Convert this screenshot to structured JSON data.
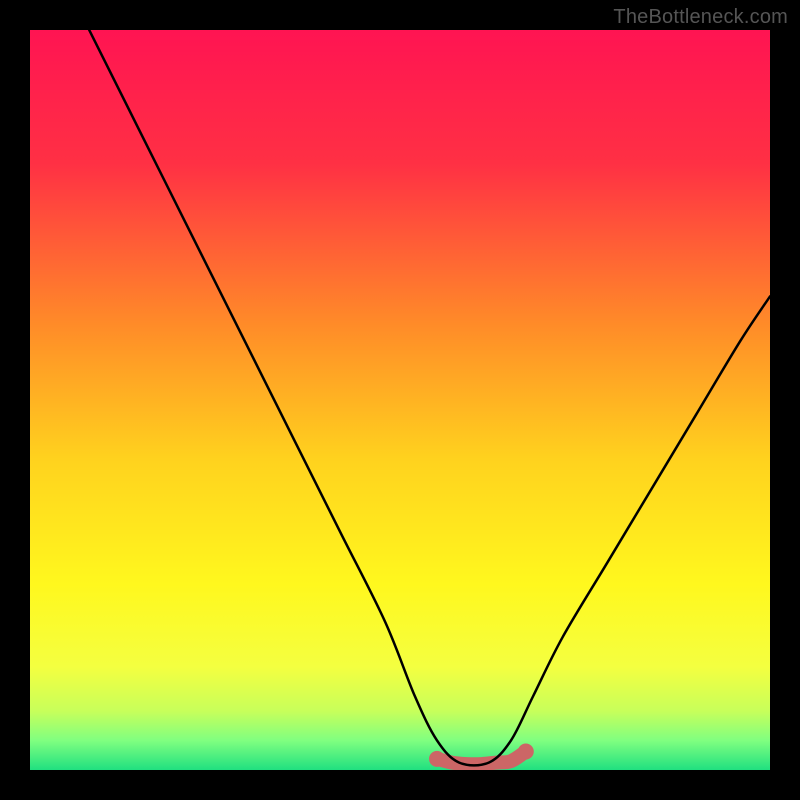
{
  "watermark": "TheBottleneck.com",
  "chart_data": {
    "type": "line",
    "title": "",
    "xlabel": "",
    "ylabel": "",
    "xlim": [
      0,
      100
    ],
    "ylim": [
      0,
      100
    ],
    "grid": false,
    "legend": false,
    "series": [
      {
        "name": "bottleneck-curve",
        "color": "#000000",
        "x": [
          8,
          12,
          18,
          24,
          30,
          36,
          42,
          48,
          52,
          55,
          58,
          62,
          65,
          68,
          72,
          78,
          84,
          90,
          96,
          100
        ],
        "y": [
          100,
          92,
          80,
          68,
          56,
          44,
          32,
          20,
          10,
          4,
          1,
          1,
          4,
          10,
          18,
          28,
          38,
          48,
          58,
          64
        ]
      },
      {
        "name": "optimal-zone",
        "color": "#cc6666",
        "x": [
          55,
          57,
          59,
          61,
          63,
          65,
          67
        ],
        "y": [
          1.5,
          1.0,
          0.8,
          0.8,
          1.0,
          1.2,
          2.5
        ]
      }
    ],
    "background_gradient": {
      "stops": [
        {
          "pos": 0.0,
          "color": "#ff1452"
        },
        {
          "pos": 0.18,
          "color": "#ff3044"
        },
        {
          "pos": 0.4,
          "color": "#ff8c28"
        },
        {
          "pos": 0.58,
          "color": "#ffd21e"
        },
        {
          "pos": 0.75,
          "color": "#fff81e"
        },
        {
          "pos": 0.86,
          "color": "#f4ff40"
        },
        {
          "pos": 0.92,
          "color": "#c8ff5a"
        },
        {
          "pos": 0.96,
          "color": "#80ff80"
        },
        {
          "pos": 1.0,
          "color": "#20e080"
        }
      ]
    }
  }
}
